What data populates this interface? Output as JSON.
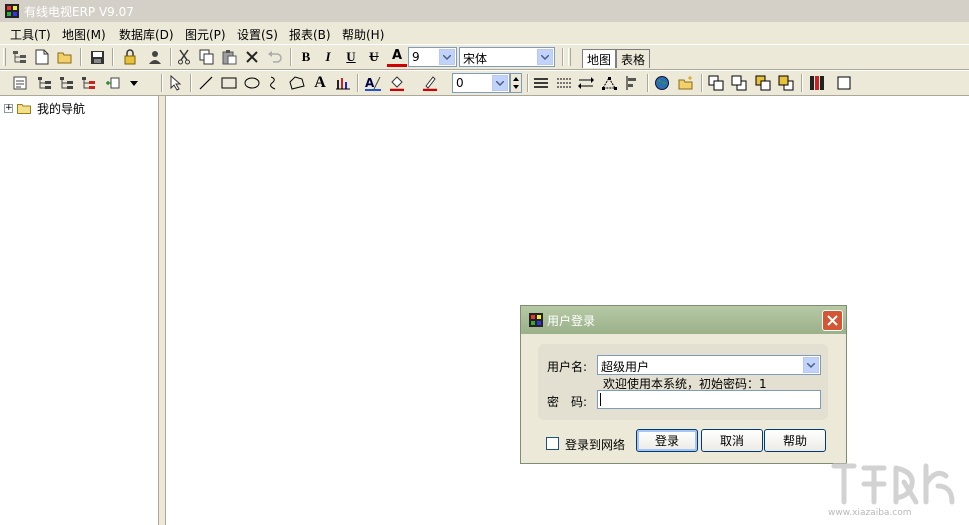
{
  "window": {
    "title": "有线电视ERP V9.07"
  },
  "menu": [
    "工具(T)",
    "地图(M)",
    "数据库(D)",
    "图元(P)",
    "设置(S)",
    "报表(B)",
    "帮助(H)"
  ],
  "toolbar1": {
    "font_size": "9",
    "font_name": "宋体",
    "tabs": [
      "地图",
      "表格"
    ],
    "format_buttons": [
      "B",
      "I",
      "U",
      "U",
      "A"
    ]
  },
  "toolbar2": {
    "text_tool_label": "A",
    "line_width": "0"
  },
  "tree": {
    "root_label": "我的导航",
    "expander": "+"
  },
  "login_dialog": {
    "title": "用户登录",
    "username_label": "用户名:",
    "username_value": "超级用户",
    "welcome_text": "欢迎使用本系统，初始密码：1",
    "password_label": "密　码:",
    "password_value": "",
    "remember_label": "登录到网络",
    "login_button": "登录",
    "cancel_button": "取消",
    "help_button": "帮助"
  },
  "watermark": {
    "text": "www.xiazaiba.com"
  }
}
